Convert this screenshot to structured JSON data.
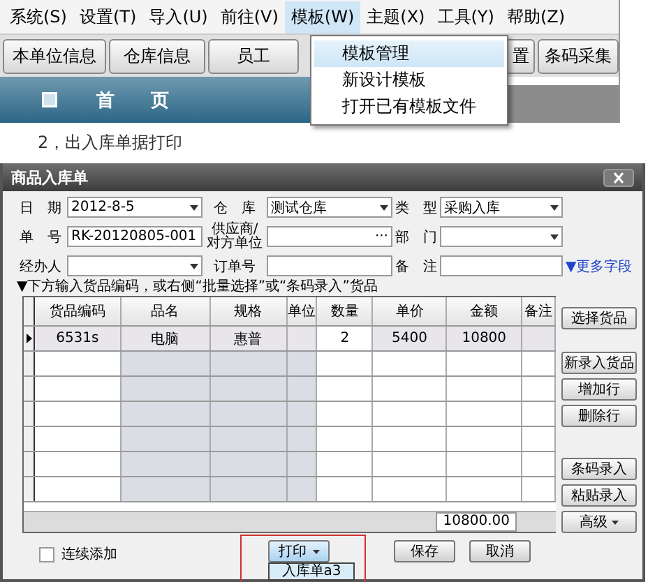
{
  "menu_bar": [
    {
      "label": "系统(S)",
      "selected": false
    },
    {
      "label": "设置(T)",
      "selected": false
    },
    {
      "label": "导入(U)",
      "selected": false
    },
    {
      "label": "前往(V)",
      "selected": false
    },
    {
      "label": "模板(W)",
      "selected": true
    },
    {
      "label": "主题(X)",
      "selected": false
    },
    {
      "label": "工具(Y)",
      "selected": false
    },
    {
      "label": "帮助(Z)",
      "selected": false
    }
  ],
  "toolbar": [
    {
      "label": "本单位信息",
      "covered": false
    },
    {
      "label": "仓库信息",
      "covered": false
    },
    {
      "label": "员工",
      "covered": false
    },
    {
      "label": "置",
      "covered": true
    },
    {
      "label": "条码采集",
      "covered": false
    }
  ],
  "home_tab": {
    "label": "首　　页"
  },
  "template_menu": [
    {
      "label": "模板管理",
      "selected": true
    },
    {
      "label": "新设计模板",
      "selected": false
    },
    {
      "label": "打开已有模板文件",
      "selected": false
    }
  ],
  "caption": "2，出入库单据打印",
  "window": {
    "title": "商品入库单",
    "form": [
      [
        {
          "label": "日　期",
          "kind": "dropdown",
          "value": "2012-8-5"
        },
        {
          "label": "仓　库",
          "kind": "dropdown",
          "value": "测试仓库"
        },
        {
          "label": "类　型",
          "kind": "dropdown",
          "value": "采购入库"
        }
      ],
      [
        {
          "label": "单　号",
          "kind": "text",
          "value": "RK-20120805-001"
        },
        {
          "label": "供应商/对方单位",
          "kind": "lookup",
          "button": "···"
        },
        {
          "label": "部　门",
          "kind": "dropdown"
        }
      ],
      [
        {
          "label": "经办人",
          "kind": "dropdown"
        },
        {
          "label": "订单号",
          "kind": "text"
        },
        {
          "label": "备　注",
          "kind": "text"
        },
        {
          "label": "▼更多字段",
          "kind": "link"
        }
      ]
    ],
    "hint": "▼下方输入货品编码，或右侧“批量选择”或“条码录入”货品",
    "table": {
      "columns": [
        {
          "label": "货品编码",
          "readonly": false
        },
        {
          "label": "品名",
          "readonly": true
        },
        {
          "label": "规格",
          "readonly": true
        },
        {
          "label": "单位",
          "readonly": true
        },
        {
          "label": "数量",
          "readonly": false
        },
        {
          "label": "单价",
          "readonly": false
        },
        {
          "label": "金额",
          "readonly": false
        },
        {
          "label": "备注",
          "readonly": false
        }
      ],
      "rows": [
        {
          "selected": true,
          "cells": [
            "6531s",
            "电脑",
            "惠普",
            null,
            "2",
            "5400",
            "10800",
            null
          ]
        },
        {
          "selected": false
        },
        {
          "selected": false
        },
        {
          "selected": false
        },
        {
          "selected": false
        },
        {
          "selected": false
        },
        {
          "selected": false
        }
      ],
      "total": "10800.00"
    },
    "side_buttons": [
      [
        {
          "label": "选择货品",
          "kind": "plain"
        }
      ],
      [
        {
          "label": "新录入货品",
          "kind": "plain"
        },
        {
          "label": "增加行",
          "kind": "plain"
        },
        {
          "label": "删除行",
          "kind": "plain"
        }
      ],
      [
        {
          "label": "条码录入",
          "kind": "plain"
        },
        {
          "label": "粘贴录入",
          "kind": "plain"
        },
        {
          "label": "高级",
          "kind": "dropdown"
        }
      ]
    ],
    "continuous_add": {
      "label": "连续添加",
      "checked": false
    },
    "buttons": [
      {
        "label": "打印",
        "kind": "split"
      },
      {
        "label": "保存",
        "kind": "plain"
      },
      {
        "label": "取消",
        "kind": "plain"
      }
    ],
    "print_menu": [
      {
        "label": "入库单a3"
      }
    ],
    "annotation_frame": true
  }
}
